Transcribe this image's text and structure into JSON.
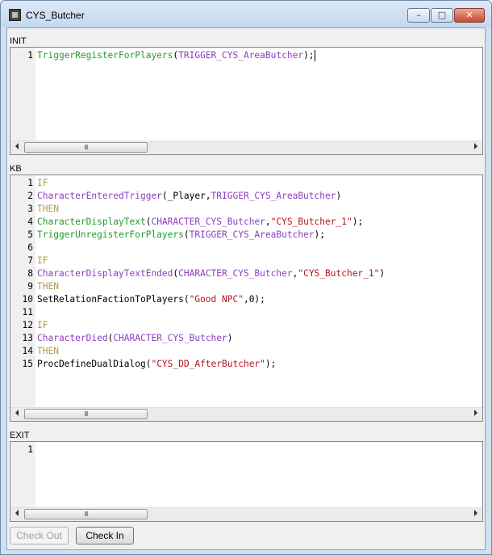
{
  "window": {
    "title": "CYS_Butcher",
    "controls": {
      "minimize": "–",
      "maximize": "□",
      "close": "✕"
    }
  },
  "sections": {
    "init": {
      "label": "INIT",
      "lines": [
        {
          "num": "1",
          "tokens": [
            {
              "t": "TriggerRegisterForPlayers",
              "c": "fn"
            },
            {
              "t": "(",
              "c": "txt"
            },
            {
              "t": "TRIGGER_CYS_AreaButcher",
              "c": "con"
            },
            {
              "t": ");",
              "c": "txt"
            }
          ]
        }
      ]
    },
    "kb": {
      "label": "KB",
      "lines": [
        {
          "num": "1",
          "tokens": [
            {
              "t": "IF",
              "c": "kw"
            }
          ]
        },
        {
          "num": "2",
          "tokens": [
            {
              "t": "CharacterEnteredTrigger",
              "c": "con"
            },
            {
              "t": "(_Player,",
              "c": "txt"
            },
            {
              "t": "TRIGGER_CYS_AreaButcher",
              "c": "con"
            },
            {
              "t": ")",
              "c": "txt"
            }
          ]
        },
        {
          "num": "3",
          "tokens": [
            {
              "t": "THEN",
              "c": "kw"
            }
          ]
        },
        {
          "num": "4",
          "tokens": [
            {
              "t": "CharacterDisplayText",
              "c": "fn"
            },
            {
              "t": "(",
              "c": "txt"
            },
            {
              "t": "CHARACTER_CYS_Butcher",
              "c": "con"
            },
            {
              "t": ",",
              "c": "txt"
            },
            {
              "t": "\"CYS_Butcher_1\"",
              "c": "str"
            },
            {
              "t": ");",
              "c": "txt"
            }
          ]
        },
        {
          "num": "5",
          "tokens": [
            {
              "t": "TriggerUnregisterForPlayers",
              "c": "fn"
            },
            {
              "t": "(",
              "c": "txt"
            },
            {
              "t": "TRIGGER_CYS_AreaButcher",
              "c": "con"
            },
            {
              "t": ");",
              "c": "txt"
            }
          ]
        },
        {
          "num": "6",
          "tokens": []
        },
        {
          "num": "7",
          "tokens": [
            {
              "t": "IF",
              "c": "kw"
            }
          ]
        },
        {
          "num": "8",
          "tokens": [
            {
              "t": "CharacterDisplayTextEnded",
              "c": "con"
            },
            {
              "t": "(",
              "c": "txt"
            },
            {
              "t": "CHARACTER_CYS_Butcher",
              "c": "con"
            },
            {
              "t": ",",
              "c": "txt"
            },
            {
              "t": "\"CYS_Butcher_1\"",
              "c": "str"
            },
            {
              "t": ")",
              "c": "txt"
            }
          ]
        },
        {
          "num": "9",
          "tokens": [
            {
              "t": "THEN",
              "c": "kw"
            }
          ]
        },
        {
          "num": "10",
          "tokens": [
            {
              "t": "SetRelationFactionToPlayers(",
              "c": "txt"
            },
            {
              "t": "\"Good NPC\"",
              "c": "str"
            },
            {
              "t": ",0);",
              "c": "txt"
            }
          ]
        },
        {
          "num": "11",
          "tokens": []
        },
        {
          "num": "12",
          "tokens": [
            {
              "t": "IF",
              "c": "kw"
            }
          ]
        },
        {
          "num": "13",
          "tokens": [
            {
              "t": "CharacterDied",
              "c": "con"
            },
            {
              "t": "(",
              "c": "txt"
            },
            {
              "t": "CHARACTER_CYS_Butcher",
              "c": "con"
            },
            {
              "t": ")",
              "c": "txt"
            }
          ]
        },
        {
          "num": "14",
          "tokens": [
            {
              "t": "THEN",
              "c": "kw"
            }
          ]
        },
        {
          "num": "15",
          "tokens": [
            {
              "t": "ProcDefineDualDialog(",
              "c": "txt"
            },
            {
              "t": "\"CYS_DD_AfterButcher\"",
              "c": "str"
            },
            {
              "t": ");",
              "c": "txt"
            }
          ]
        }
      ]
    },
    "exit": {
      "label": "EXIT",
      "lines": [
        {
          "num": "1",
          "tokens": []
        }
      ]
    }
  },
  "scrollbar": {
    "thumb_grip": "III"
  },
  "buttons": {
    "check_out": "Check Out",
    "check_in": "Check In"
  },
  "colors": {
    "function": "#239a2a",
    "constant": "#8d3fbd",
    "keyword": "#b39b4a",
    "string": "#b3141e"
  }
}
